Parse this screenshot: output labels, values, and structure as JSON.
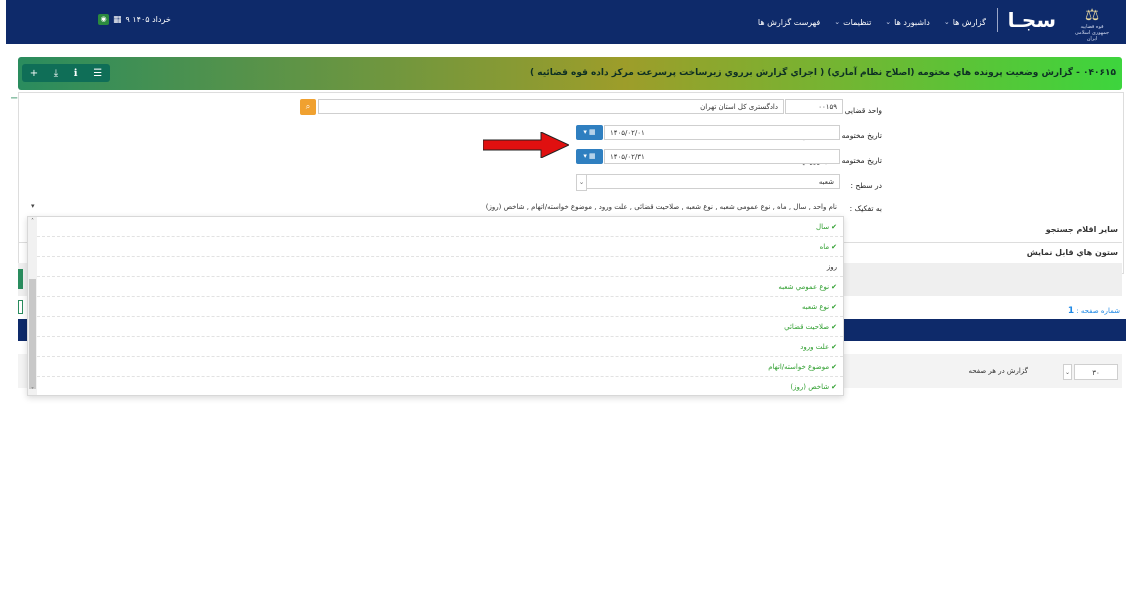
{
  "header": {
    "logo_caption": "قوه قضاییه جمهوری اسلامی ایران",
    "brand": "سجـا",
    "nav": [
      {
        "label": "گزارش ها"
      },
      {
        "label": "داشبورد ها"
      },
      {
        "label": "تنظیمات"
      },
      {
        "label": "فهرست گزارش ها"
      }
    ],
    "date": "۹ خرداد ۱۴۰۵"
  },
  "panel": {
    "title": "۰۴۰۶۱۵ - گزارش وضعیت پرونده هاي مختومه (اصلاح نظام آماري) ( اجراي گزارش برروي زيرساخت پرسرعت مرکز داده قوه قضائيه )"
  },
  "form": {
    "unit_label": "واحد قضایی :",
    "unit_code": "۰۰۱۵۹",
    "unit_name": "دادگستری کل استان تهران",
    "from_label": "تاریخ مختومه شدن ورودي از :",
    "from_value": "۱۴۰۵/۰۲/۰۱",
    "to_label": "تاریخ مختومه شدن ورودي تا :",
    "to_value": "۱۴۰۵/۰۲/۳۱",
    "level_label": "در سطح :",
    "level_value": "شعبه",
    "breakdown_label": "به تفکیک :",
    "breakdown_value": "نام واحد , سال , ماه , نوع عمومی شعبه , نوع شعبه , صلاحیت قضائی , علت ورود , موضوع خواسته/اتهام , شاخص (روز)"
  },
  "sections": {
    "other_search": "سایر اقلام جستجو",
    "columns": "ستون هاي قابل نمايش"
  },
  "dropdown": {
    "items": [
      {
        "label": "سال",
        "checked": true
      },
      {
        "label": "ماه",
        "checked": true
      },
      {
        "label": "روز",
        "checked": false
      },
      {
        "label": "نوع عمومي شعبه",
        "checked": true
      },
      {
        "label": "نوع شعبه",
        "checked": true
      },
      {
        "label": "صلاحيت قضائي",
        "checked": true
      },
      {
        "label": "علت ورود",
        "checked": true
      },
      {
        "label": "موضوع خواسته/اتهام",
        "checked": true
      },
      {
        "label": "شاخص (روز)",
        "checked": true
      }
    ]
  },
  "pager": {
    "page_label": "شماره صفحه :",
    "page_value": "1",
    "per_page_label": "گزارش در هر صفحه",
    "per_page_value": "۳۰"
  },
  "colors": {
    "topbar": "#0e2a6a",
    "accent_green": "#2e9e2e",
    "calendar_button": "#2f7fc0",
    "search_button": "#f0a130",
    "arrow": "#e01010"
  }
}
